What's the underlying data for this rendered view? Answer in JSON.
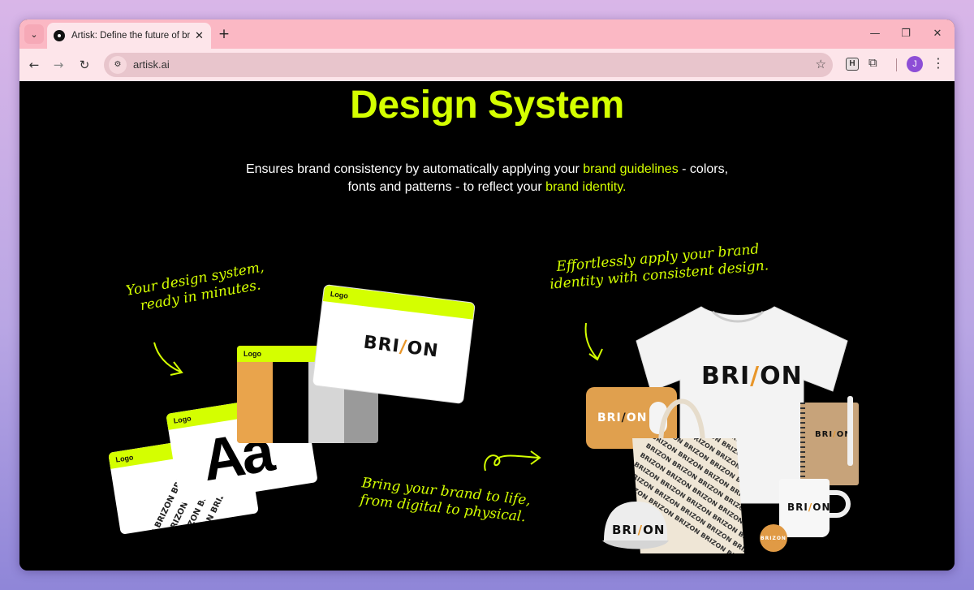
{
  "browser": {
    "tab_title": "Artisk: Define the future of bran",
    "tab_close": "✕",
    "new_tab": "+",
    "tab_search_icon": "⌄",
    "minimize": "—",
    "restore": "❐",
    "close": "✕",
    "back": "←",
    "forward": "→",
    "reload": "↻",
    "site_info_icon": "⚙",
    "url": "artisk.ai",
    "bookmark_star": "☆",
    "extension_h": "H",
    "extensions_icon": "⧉",
    "profile_initial": "J",
    "menu": "⋮"
  },
  "page": {
    "headline": "Design System",
    "subtitle": {
      "part1": "Ensures brand consistency by automatically applying your ",
      "highlight1": "brand guidelines",
      "part2": " - colors, fonts and patterns - to reflect your ",
      "highlight2": "brand identity."
    },
    "annotations": {
      "left": [
        "Your design system,",
        "ready in minutes."
      ],
      "right": [
        "Effortlessly apply your brand",
        "identity with consistent design."
      ],
      "bottom": [
        "Bring your brand to life,",
        "from digital to physical."
      ]
    },
    "cards": {
      "logo_label": "Logo",
      "brand_text": "BRIZON",
      "brand_pre": "BRI",
      "brand_slash": "/",
      "brand_post": "ON",
      "typeface_sample": "Aa",
      "pattern_text": "BRIZON BRIZON BRIZON BRIZON BRIZON"
    },
    "colors": {
      "accent": "#d4ff00",
      "brand_orange": "#e8962a",
      "background": "#000000"
    }
  }
}
